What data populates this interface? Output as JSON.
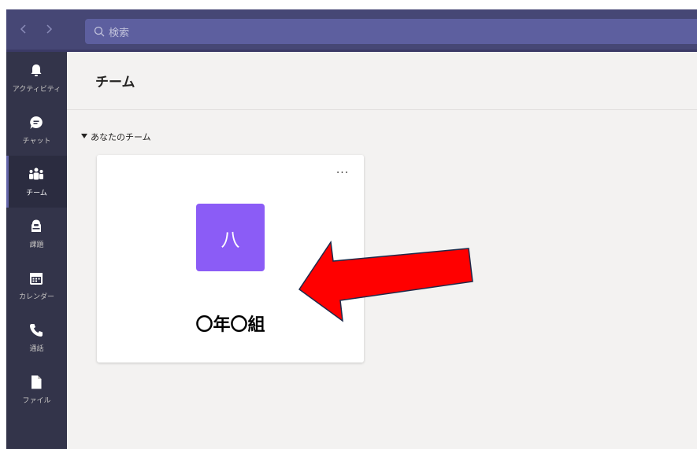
{
  "search": {
    "placeholder": "検索"
  },
  "rail": {
    "items": [
      {
        "label": "アクティビティ",
        "icon": "bell-icon"
      },
      {
        "label": "チャット",
        "icon": "chat-icon"
      },
      {
        "label": "チーム",
        "icon": "teams-icon",
        "active": true
      },
      {
        "label": "課題",
        "icon": "assignments-icon"
      },
      {
        "label": "カレンダー",
        "icon": "calendar-icon"
      },
      {
        "label": "通話",
        "icon": "phone-icon"
      },
      {
        "label": "ファイル",
        "icon": "file-icon"
      }
    ]
  },
  "main": {
    "title": "チーム",
    "section_label": "あなたのチーム",
    "card": {
      "avatar_text": "八",
      "more_label": "···",
      "team_name": "〇年〇組"
    }
  },
  "annotation": {
    "arrow_color": "#ff0000"
  },
  "colors": {
    "accent": "#6264a7",
    "avatar": "#8b5cf6",
    "rail": "#33344a",
    "topbar": "#464775"
  }
}
